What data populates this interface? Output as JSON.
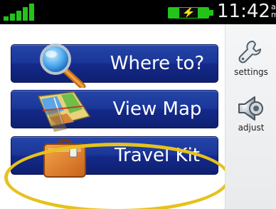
{
  "status_bar": {
    "time": "11:42",
    "ampm_top": "a",
    "ampm_bottom": "m",
    "signal_icon": "signal-bars-icon",
    "battery_icon": "battery-charging-icon"
  },
  "menu": {
    "items": [
      {
        "label": "Where to?",
        "icon": "magnifier-icon"
      },
      {
        "label": "View Map",
        "icon": "map-icon"
      },
      {
        "label": "Travel Kit",
        "icon": "suitcase-icon"
      }
    ],
    "highlighted": "Travel Kit"
  },
  "sidebar": {
    "items": [
      {
        "label": "settings",
        "icon": "wrench-icon"
      },
      {
        "label": "adjust",
        "icon": "speaker-icon"
      }
    ]
  },
  "colors": {
    "button_blue": "#1a3698",
    "highlight_yellow": "#e6c21c",
    "status_green": "#22c41a"
  }
}
